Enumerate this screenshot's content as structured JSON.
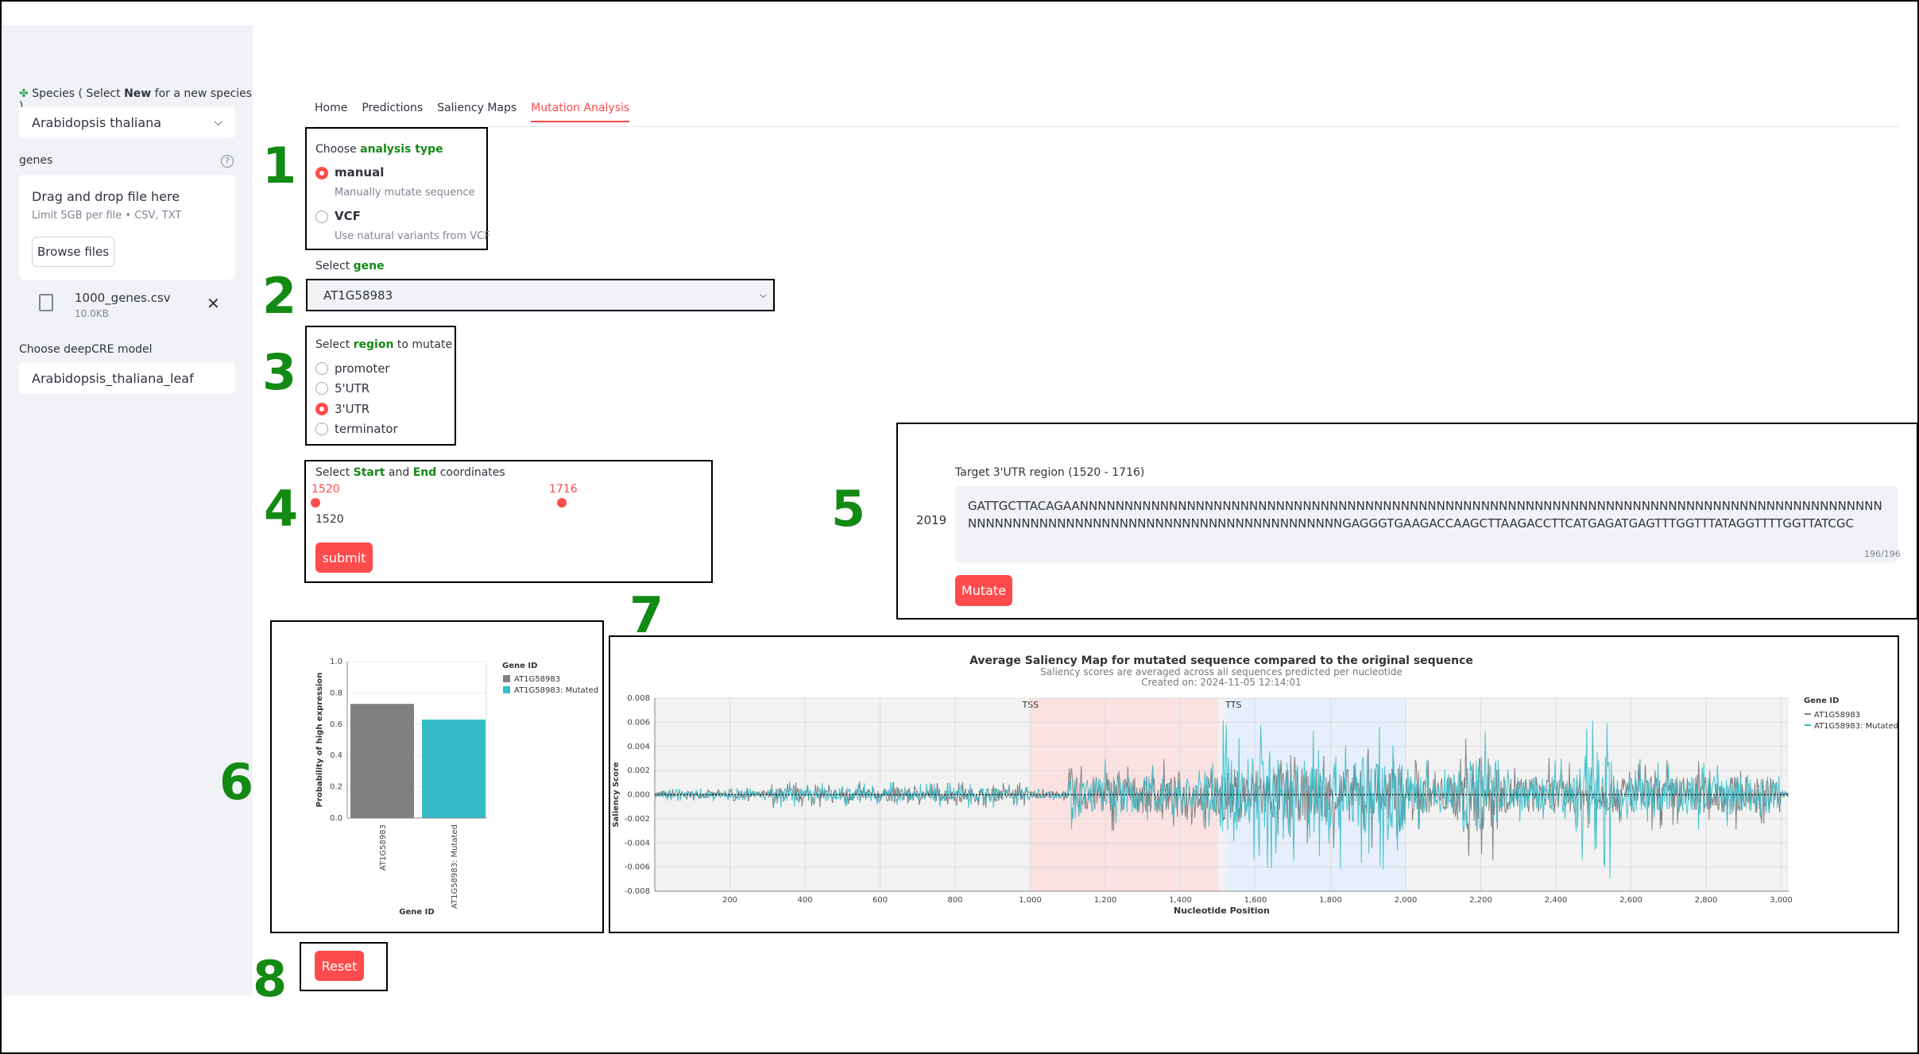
{
  "sidebar": {
    "species_label_pre": "Species ( Select ",
    "species_label_bold": "New",
    "species_label_post": " for a new species )",
    "species_value": "Arabidopsis thaliana",
    "genes_label": "genes",
    "help_glyph": "?",
    "dropzone_title": "Drag and drop file here",
    "dropzone_limit": "Limit 5GB per file • CSV, TXT",
    "browse_label": "Browse files",
    "file_name": "1000_genes.csv",
    "file_size": "10.0KB",
    "model_label": "Choose deepCRE model",
    "model_value": "Arabidopsis_thaliana_leaf"
  },
  "tabs": [
    "Home",
    "Predictions",
    "Saliency Maps",
    "Mutation Analysis"
  ],
  "active_tab": 3,
  "steps": [
    "1",
    "2",
    "3",
    "4",
    "5",
    "6",
    "7",
    "8"
  ],
  "analysis": {
    "label_pre": "Choose ",
    "label_bold": "analysis type",
    "options": [
      {
        "label": "manual",
        "caption": "Manually mutate sequence",
        "selected": true
      },
      {
        "label": "VCF",
        "caption": "Use natural variants from VCF",
        "selected": false
      }
    ]
  },
  "gene": {
    "label_pre": "Select ",
    "label_bold": "gene",
    "value": "AT1G58983"
  },
  "region": {
    "label_pre": "Select ",
    "label_bold": "region",
    "label_post": " to mutate",
    "options": [
      "promoter",
      "5'UTR",
      "3'UTR",
      "terminator"
    ],
    "selected": 2
  },
  "coords": {
    "label_pre": "Select ",
    "label_bold1": "Start",
    "label_mid": " and ",
    "label_bold2": "End",
    "label_post": " coordinates",
    "start": "1520",
    "end": "1716",
    "value_text": "1520",
    "submit": "submit"
  },
  "mutate": {
    "title": "Target 3'UTR region (1520 - 1716)",
    "row_index": "2019",
    "sequence": "GATTGCTTACAGAANNNNNNNNNNNNNNNNNNNNNNNNNNNNNNNNNNNNNNNNNNNNNNNNNNNNNNNNNNNNNNNNNNNNNNNNNNNNNNNNNNNNNNNNNNNNNNNNNNNNNNNNNNNNNNNNNNNNNNNNNNNNNNNNNNNNGAGGGTGAAGACCAAGCTTAAGACCTTCATGAGATGAGTTTGGTTTATAGGTTTTGGTTATCGC",
    "char_count": "196/196",
    "button": "Mutate"
  },
  "reset": "Reset",
  "colors": {
    "accent": "#ff4b4b",
    "green": "#138a14",
    "original": "#808080",
    "mutated": "#35bcc9"
  },
  "bar_chart": {
    "chart_data": {
      "type": "bar",
      "categories": [
        "AT1G58983",
        "AT1G58983: Mutated"
      ],
      "values": [
        0.73,
        0.63
      ],
      "xlabel": "Gene ID",
      "ylabel": "Probability of high expression",
      "ylim": [
        0,
        1
      ],
      "yticks": [
        "0.0",
        "0.2",
        "0.4",
        "0.6",
        "0.8",
        "1.0"
      ],
      "legend_title": "Gene ID",
      "legend": [
        "AT1G58983",
        "AT1G58983: Mutated"
      ]
    }
  },
  "line_chart": {
    "chart_data": {
      "type": "line",
      "title": "Average Saliency Map for mutated sequence compared to the original sequence",
      "subtitle": "Saliency scores are averaged across all sequences predicted per nucleotide",
      "created": "Created on: 2024-11-05 12:14:01",
      "xlabel": "Nucleotide Position",
      "ylabel": "Saliency Score",
      "xlim": [
        0,
        3020
      ],
      "ylim": [
        -0.008,
        0.008
      ],
      "xticks": [
        "200",
        "400",
        "600",
        "800",
        "1,000",
        "1,200",
        "1,400",
        "1,600",
        "1,800",
        "2,000",
        "2,200",
        "2,400",
        "2,600",
        "2,800",
        "3,000"
      ],
      "yticks": [
        "0.008",
        "0.006",
        "0.004",
        "0.002",
        "0.000",
        "-0.002",
        "-0.004",
        "-0.006",
        "-0.008"
      ],
      "regions": [
        {
          "label": "TSS",
          "from": 1000,
          "to": 1500,
          "color": "#fbe1e1"
        },
        {
          "label": "TTS",
          "from": 1520,
          "to": 2000,
          "color": "#e6effb"
        }
      ],
      "legend_title": "Gene ID",
      "legend": [
        "AT1G58983",
        "AT1G58983: Mutated"
      ],
      "series_note": "noisy saliency traces for original (grey) and mutated (teal) sequences"
    }
  }
}
